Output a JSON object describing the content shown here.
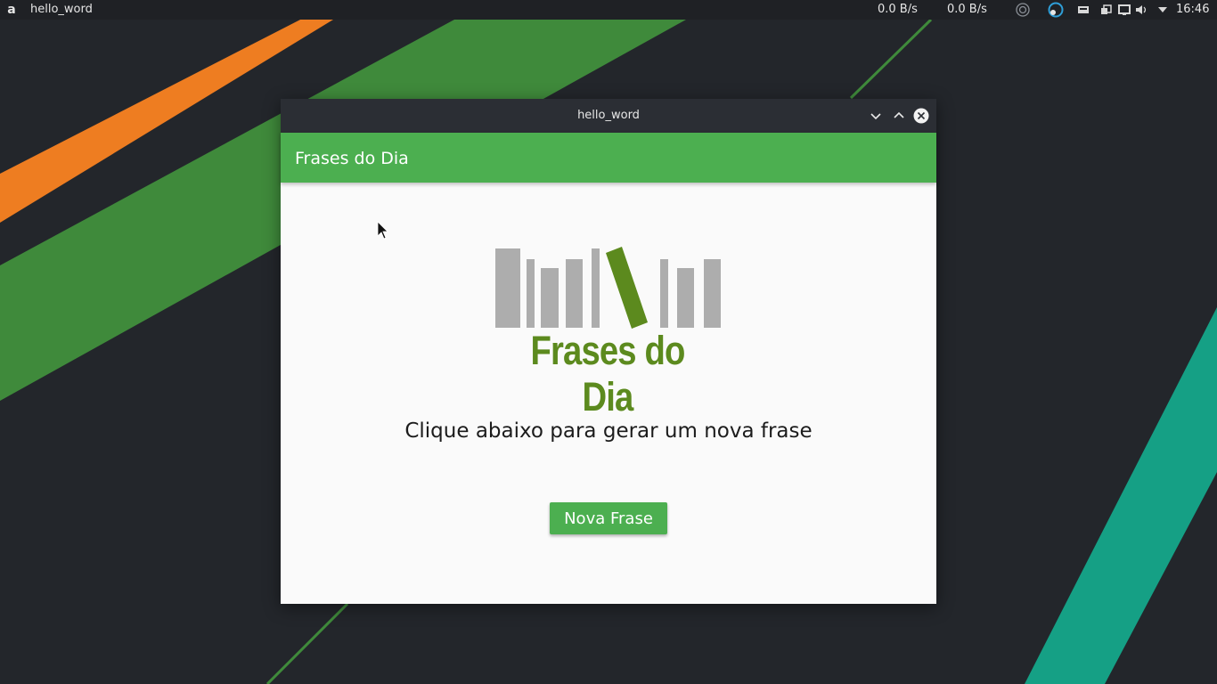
{
  "panel": {
    "app_icon_glyph": "a",
    "app_title": "hello_word",
    "net_down": "0.0 B/s",
    "net_up": "0.0 B/s",
    "clock": "16:46",
    "tray_icons": [
      "circle-status-icon",
      "network-ring-icon",
      "storage-icon",
      "clipboard-icon",
      "display-icon",
      "volume-icon",
      "dropdown-arrow-icon"
    ]
  },
  "window": {
    "title": "hello_word",
    "appbar_title": "Frases do Dia",
    "logo_text": "Frases do Dia",
    "prompt": "Clique abaixo para gerar um nova frase",
    "button_label": "Nova Frase"
  },
  "colors": {
    "accent_green": "#4caf50",
    "logo_green": "#5c8a1e",
    "logo_gray": "#adadad",
    "wallpaper_orange": "#ee7d21",
    "wallpaper_green": "#3f8a3b",
    "wallpaper_teal": "#15a085",
    "panel_bg": "#1f2125",
    "titlebar_bg": "#2b2e34"
  }
}
